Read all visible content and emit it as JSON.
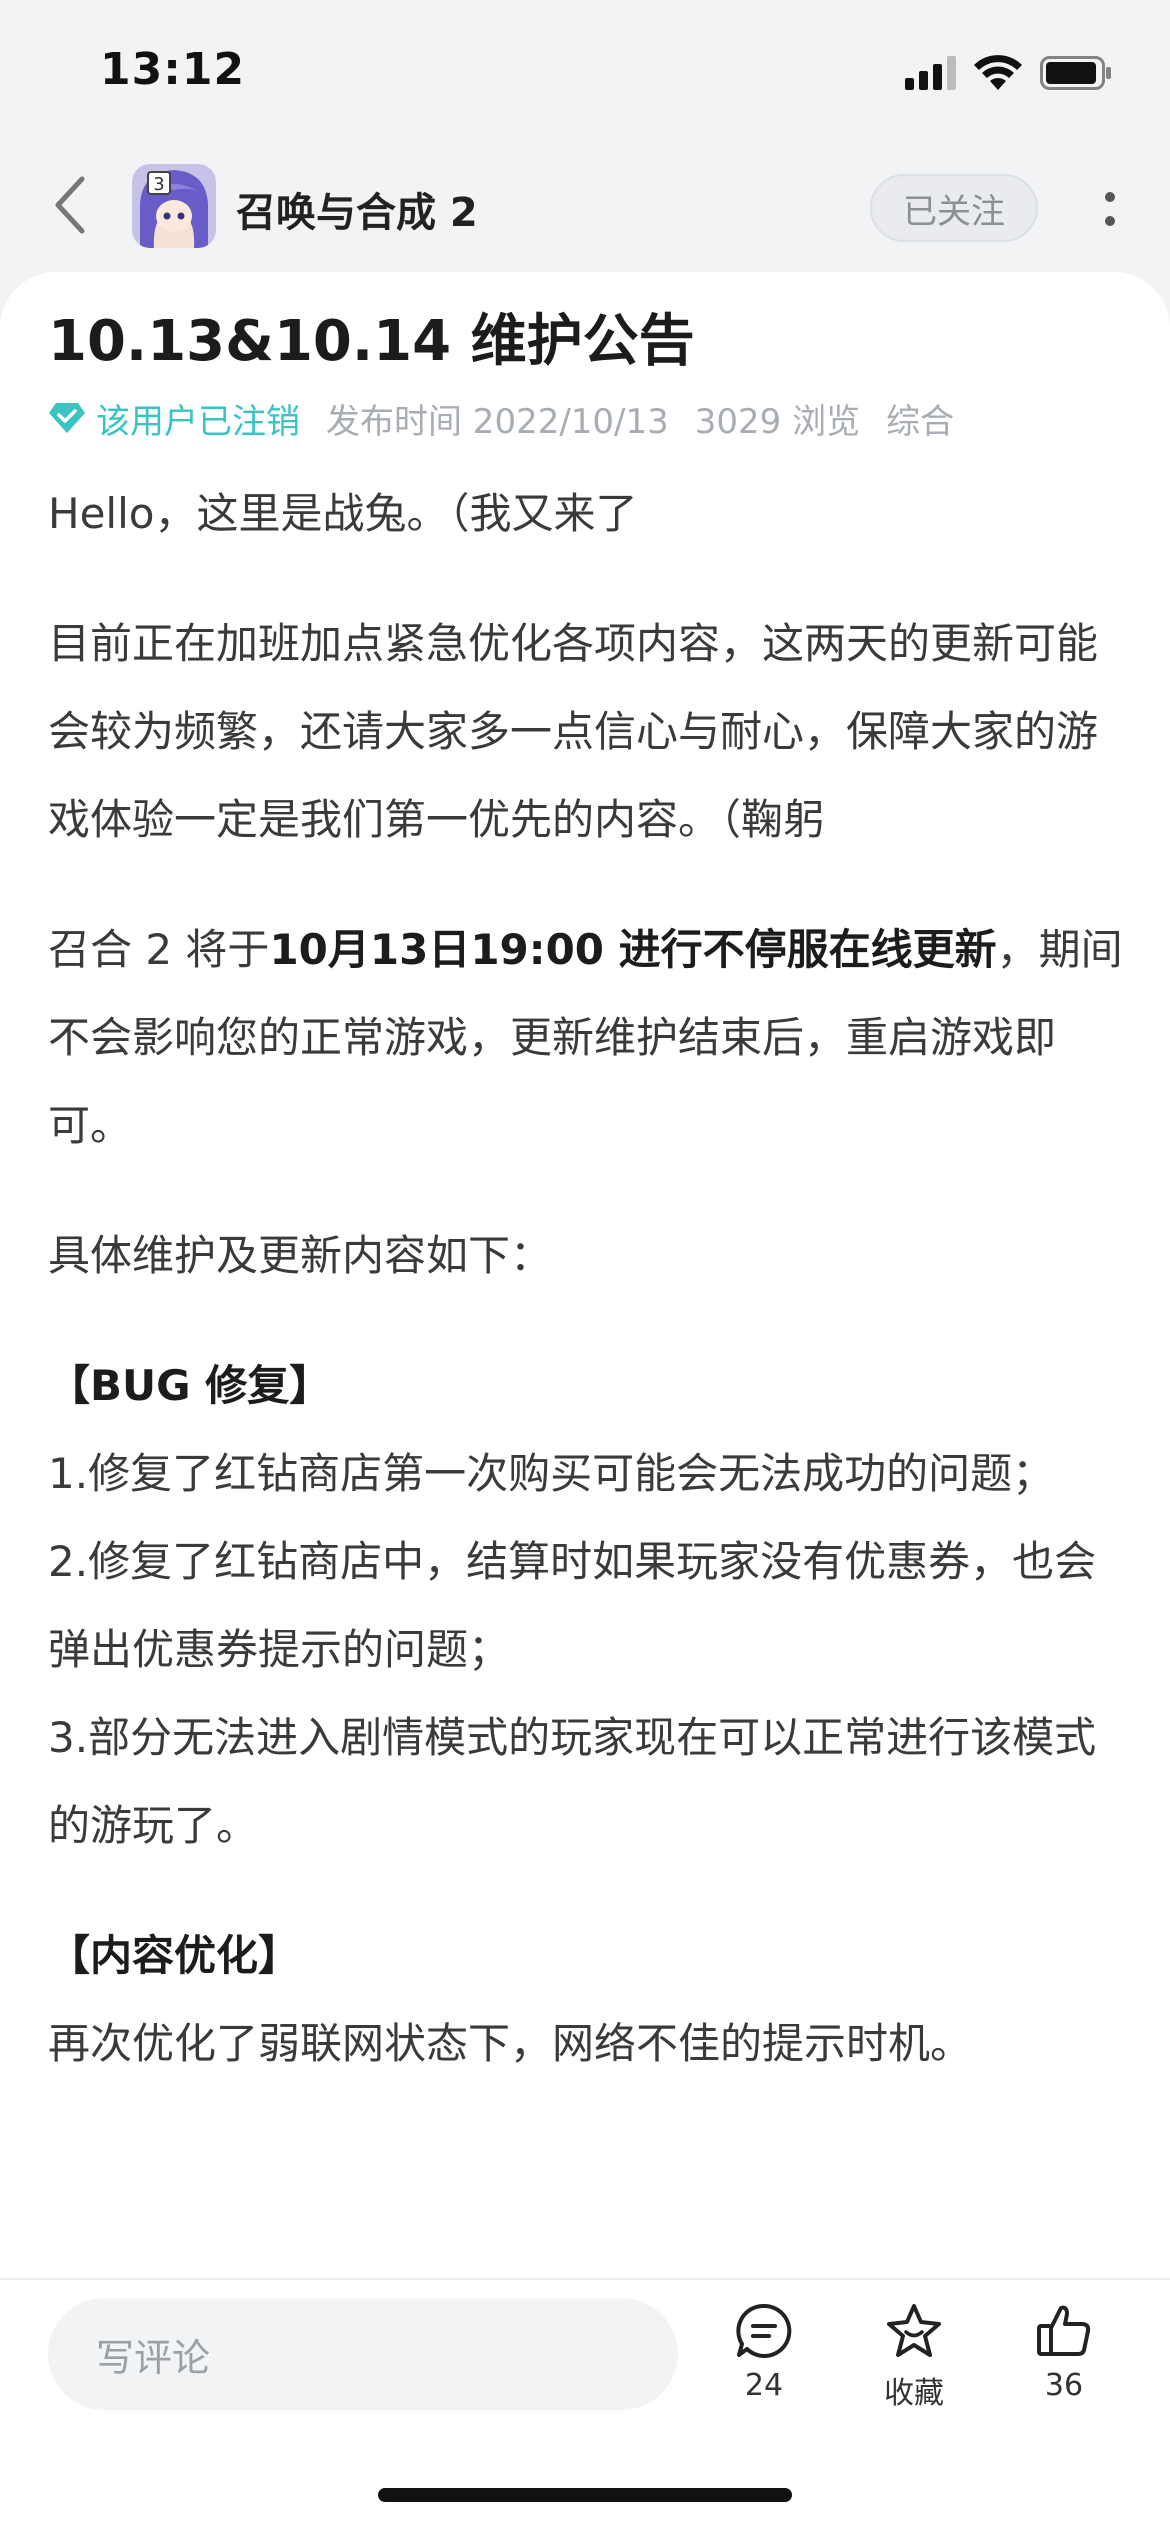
{
  "status_bar": {
    "time": "13:12"
  },
  "nav": {
    "game_title": "召唤与合成 2",
    "follow_label": "已关注",
    "avatar_badge": "3"
  },
  "post": {
    "title": "10.13&10.14 维护公告",
    "author": "该用户已注销",
    "publish_time": "发布时间 2022/10/13",
    "views": "3029 浏览",
    "category": "综合",
    "paragraphs": {
      "p1": "Hello，这里是战兔。（我又来了",
      "p2": "目前正在加班加点紧急优化各项内容，这两天的更新可能会较为频繁，还请大家多一点信心与耐心，保障大家的游戏体验一定是我们第一优先的内容。（鞠躬",
      "p3_prefix": "召合 2 将于",
      "p3_bold": "10月13日19:00 进行不停服在线更新",
      "p3_suffix": "，期间不会影响您的正常游戏，更新维护结束后，重启游戏即可。",
      "p4": "具体维护及更新内容如下："
    },
    "bug_section": {
      "heading": "【BUG 修复】",
      "items": [
        "1.修复了红钻商店第一次购买可能会无法成功的问题；",
        "2.修复了红钻商店中，结算时如果玩家没有优惠券，也会弹出优惠券提示的问题；",
        "3.部分无法进入剧情模式的玩家现在可以正常进行该模式的游玩了。"
      ]
    },
    "opt_section": {
      "heading": "【内容优化】",
      "items": [
        "再次优化了弱联网状态下，网络不佳的提示时机。"
      ]
    }
  },
  "bottom_bar": {
    "comment_placeholder": "写评论",
    "comment_count": "24",
    "favorite_label": "收藏",
    "like_count": "36"
  },
  "colors": {
    "accent_teal": "#3ac3c3",
    "background": "#f2f3f5"
  }
}
